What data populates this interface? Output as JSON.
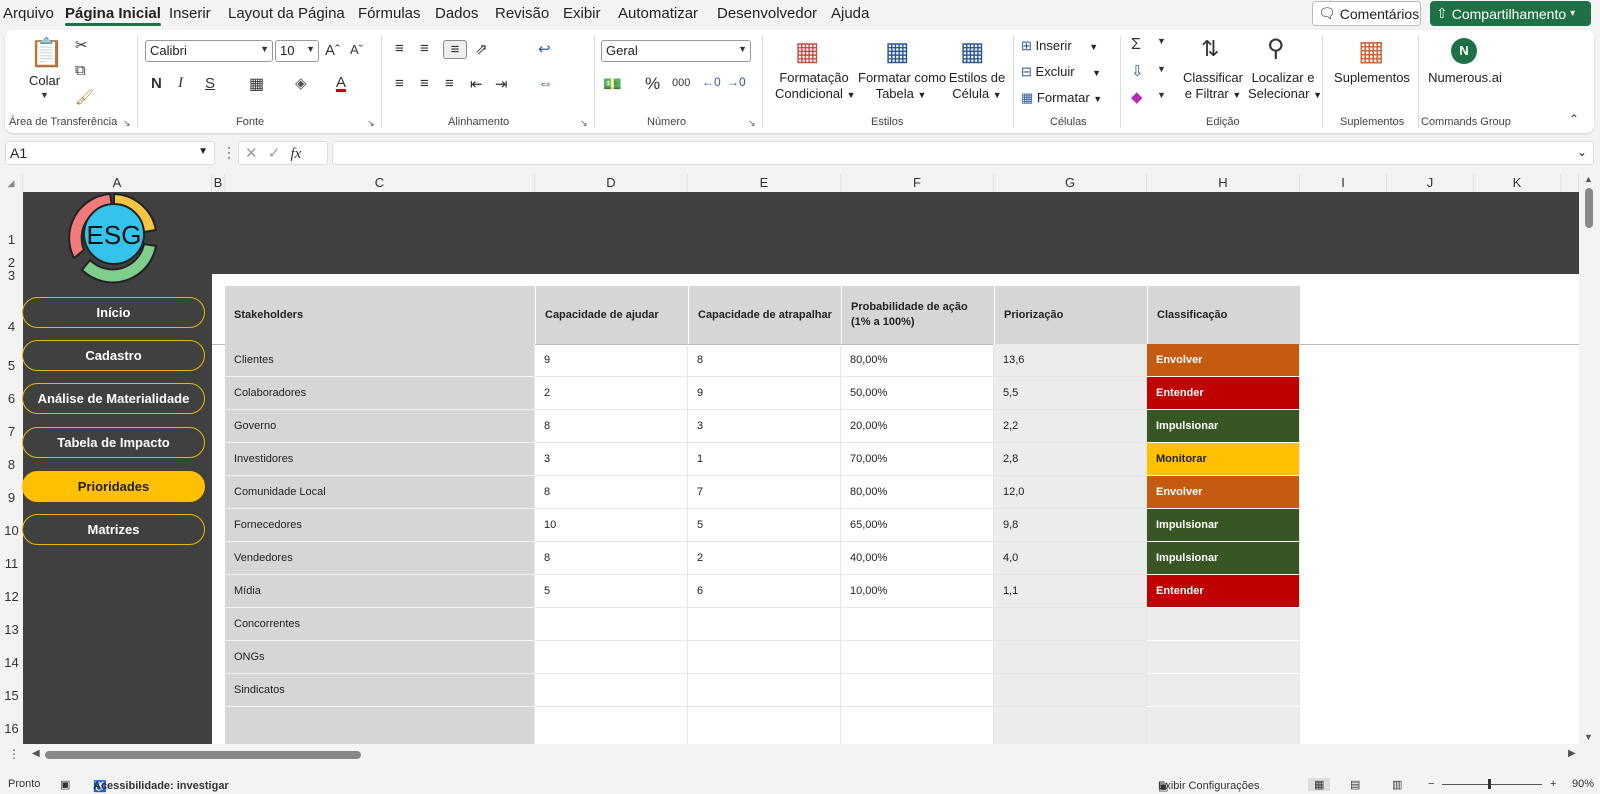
{
  "menu": {
    "tabs": [
      "Arquivo",
      "Página Inicial",
      "Inserir",
      "Layout da Página",
      "Fórmulas",
      "Dados",
      "Revisão",
      "Exibir",
      "Automatizar",
      "Desenvolvedor",
      "Ajuda"
    ],
    "active_tab": "Página Inicial",
    "comments_label": "Comentários",
    "share_label": "Compartilhamento"
  },
  "ribbon": {
    "clipboard": {
      "paste_label": "Colar",
      "group_label": "Área de Transferência"
    },
    "font": {
      "name": "Calibri",
      "size": "10",
      "group_label": "Fonte",
      "bold": "N",
      "italic": "I",
      "strike": "S"
    },
    "alignment": {
      "group_label": "Alinhamento"
    },
    "number": {
      "format": "Geral",
      "group_label": "Número",
      "percent": "%",
      "thousands": "000"
    },
    "styles": {
      "conditional_label_1": "Formatação",
      "conditional_label_2": "Condicional",
      "table_label_1": "Formatar como",
      "table_label_2": "Tabela",
      "cell_styles_label_1": "Estilos de",
      "cell_styles_label_2": "Célula",
      "group_label": "Estilos"
    },
    "cells": {
      "insert_label": "Inserir",
      "delete_label": "Excluir",
      "format_label": "Formatar",
      "group_label": "Células"
    },
    "editing": {
      "sort_label_1": "Classificar",
      "sort_label_2": "e Filtrar",
      "find_label_1": "Localizar e",
      "find_label_2": "Selecionar",
      "group_label": "Edição"
    },
    "addins": {
      "label": "Suplementos",
      "group_label": "Suplementos"
    },
    "commands": {
      "label": "Numerous.ai",
      "group_label": "Commands Group"
    }
  },
  "formula_bar": {
    "name_box": "A1",
    "fx": "fx",
    "value": ""
  },
  "columns": [
    "A",
    "B",
    "C",
    "D",
    "E",
    "F",
    "G",
    "H",
    "I",
    "J",
    "K"
  ],
  "rows": [
    "1",
    "2",
    "3",
    "4",
    "5",
    "6",
    "7",
    "8",
    "9",
    "10",
    "11",
    "12",
    "13",
    "14",
    "15",
    "16"
  ],
  "logo_text": "ESG",
  "nav": [
    {
      "label": "Início",
      "active": false
    },
    {
      "label": "Cadastro",
      "active": false
    },
    {
      "label": "Análise de Materialidade",
      "active": false
    },
    {
      "label": "Tabela de Impacto",
      "active": false
    },
    {
      "label": "Prioridades",
      "active": true
    },
    {
      "label": "Matrizes",
      "active": false
    }
  ],
  "table": {
    "headers": [
      "Stakeholders",
      "Capacidade de ajudar",
      "Capacidade de atrapalhar",
      "Probabilidade de ação (1% a 100%)",
      "Priorização",
      "Classificação"
    ],
    "rows": [
      {
        "name": "Clientes",
        "help": "9",
        "hinder": "8",
        "prob": "80,00%",
        "prio": "13,6",
        "class": "Envolver",
        "color": "#c55a11"
      },
      {
        "name": "Colaboradores",
        "help": "2",
        "hinder": "9",
        "prob": "50,00%",
        "prio": "5,5",
        "class": "Entender",
        "color": "#c00000"
      },
      {
        "name": "Governo",
        "help": "8",
        "hinder": "3",
        "prob": "20,00%",
        "prio": "2,2",
        "class": "Impulsionar",
        "color": "#375623"
      },
      {
        "name": "Investidores",
        "help": "3",
        "hinder": "1",
        "prob": "70,00%",
        "prio": "2,8",
        "class": "Monitorar",
        "color": "#ffc000"
      },
      {
        "name": "Comunidade Local",
        "help": "8",
        "hinder": "7",
        "prob": "80,00%",
        "prio": "12,0",
        "class": "Envolver",
        "color": "#c55a11"
      },
      {
        "name": "Fornecedores",
        "help": "10",
        "hinder": "5",
        "prob": "65,00%",
        "prio": "9,8",
        "class": "Impulsionar",
        "color": "#375623"
      },
      {
        "name": "Vendedores",
        "help": "8",
        "hinder": "2",
        "prob": "40,00%",
        "prio": "4,0",
        "class": "Impulsionar",
        "color": "#375623"
      },
      {
        "name": "Mídia",
        "help": "5",
        "hinder": "6",
        "prob": "10,00%",
        "prio": "1,1",
        "class": "Entender",
        "color": "#c00000"
      },
      {
        "name": "Concorrentes",
        "help": "",
        "hinder": "",
        "prob": "",
        "prio": "",
        "class": "",
        "color": ""
      },
      {
        "name": "ONGs",
        "help": "",
        "hinder": "",
        "prob": "",
        "prio": "",
        "class": "",
        "color": ""
      },
      {
        "name": "Sindicatos",
        "help": "",
        "hinder": "",
        "prob": "",
        "prio": "",
        "class": "",
        "color": ""
      },
      {
        "name": "",
        "help": "",
        "hinder": "",
        "prob": "",
        "prio": "",
        "class": "",
        "color": ""
      }
    ]
  },
  "status": {
    "ready": "Pronto",
    "accessibility": "Acessibilidade: investigar",
    "display_settings": "Exibir Configurações",
    "zoom": "90%"
  }
}
